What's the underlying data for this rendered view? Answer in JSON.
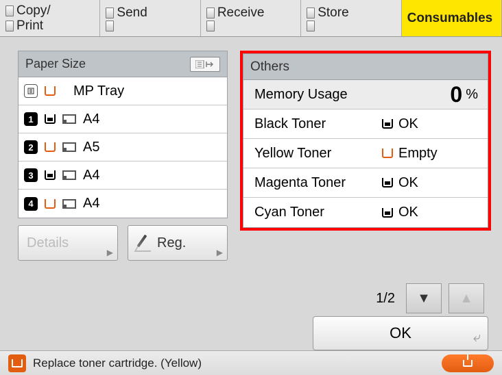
{
  "tabs": {
    "copy_print_l1": "Copy/",
    "copy_print_l2": "Print",
    "send": "Send",
    "receive": "Receive",
    "store": "Store",
    "consumables": "Consumables"
  },
  "paper_panel": {
    "title": "Paper Size",
    "rows": [
      {
        "num": "",
        "tray": "empty",
        "size": "MP Tray",
        "page_icon": false
      },
      {
        "num": "1",
        "tray": "full",
        "size": "A4",
        "page_icon": true
      },
      {
        "num": "2",
        "tray": "empty",
        "size": "A5",
        "page_icon": true
      },
      {
        "num": "3",
        "tray": "full",
        "size": "A4",
        "page_icon": true
      },
      {
        "num": "4",
        "tray": "empty",
        "size": "A4",
        "page_icon": true
      }
    ],
    "details_label": "Details",
    "reg_label": "Reg."
  },
  "others_panel": {
    "title": "Others",
    "memory_label": "Memory Usage",
    "memory_value": "0",
    "memory_unit": "%",
    "toners": [
      {
        "name": "Black Toner",
        "status": "OK",
        "icon": "full"
      },
      {
        "name": "Yellow Toner",
        "status": "Empty",
        "icon": "empty"
      },
      {
        "name": "Magenta Toner",
        "status": "OK",
        "icon": "full"
      },
      {
        "name": "Cyan Toner",
        "status": "OK",
        "icon": "full"
      }
    ]
  },
  "pager": {
    "label": "1/2"
  },
  "ok_label": "OK",
  "status": {
    "message": "Replace toner cartridge. (Yellow)"
  }
}
